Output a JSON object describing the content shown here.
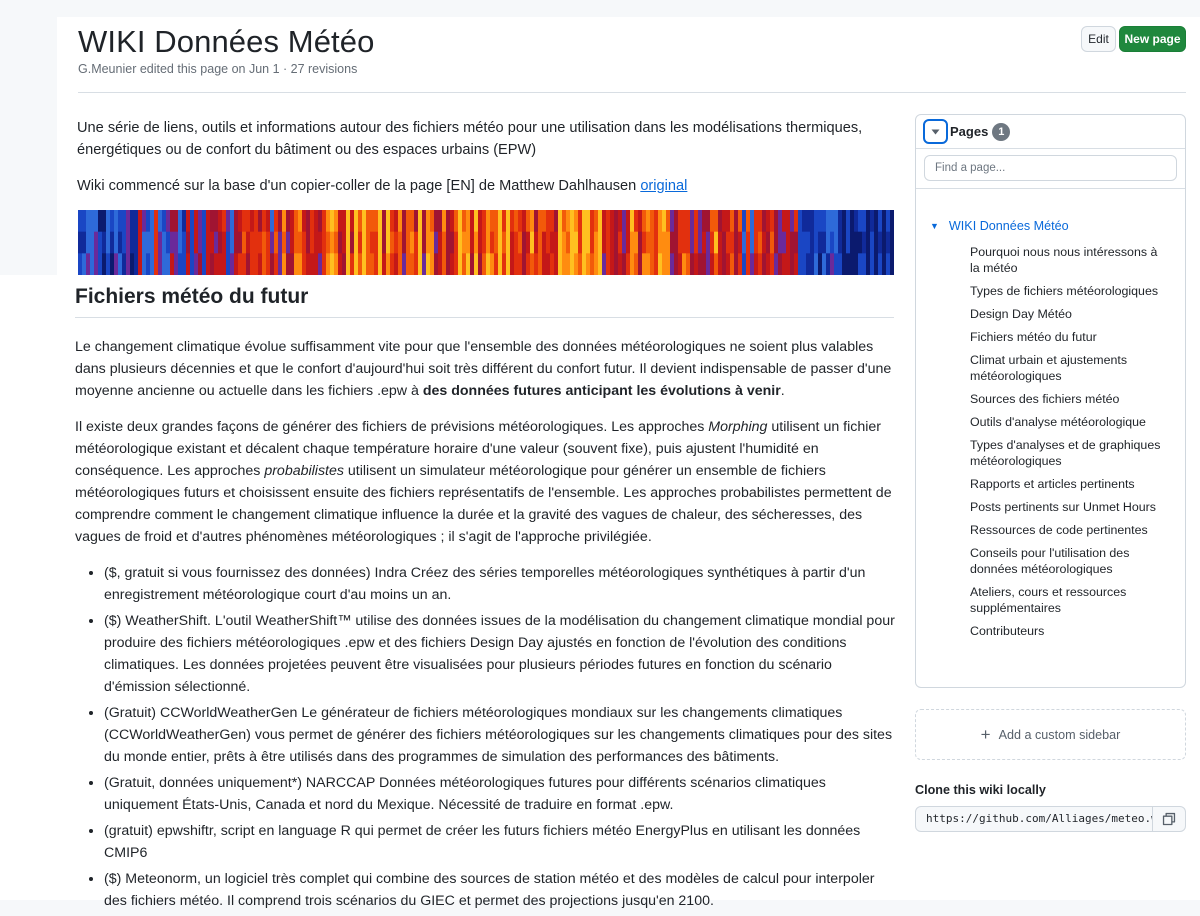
{
  "header": {
    "title": "WIKI Données Météo",
    "subtitle": "G.Meunier edited this page on Jun 1 · 27 revisions",
    "edit_label": "Edit",
    "new_page_label": "New page"
  },
  "intro": {
    "p1": "Une série de liens, outils et informations autour des fichiers météo pour une utilisation dans les modélisations thermiques, énergétiques ou de confort du bâtiment ou des espaces urbains (EPW)",
    "p2_text": "Wiki commencé sur la base d'un copier-coller de la page [EN] de Matthew Dahlhausen ",
    "p2_link": "original"
  },
  "section": {
    "heading": "Fichiers météo du futur",
    "p1_text": "Le changement climatique évolue suffisamment vite pour que l'ensemble des données météorologiques ne soient plus valables dans plusieurs décennies et que le confort d'aujourd'hui soit très différent du confort futur. Il devient indispensable de passer d'une moyenne ancienne ou actuelle dans les fichiers .epw à ",
    "p1_bold": "des données futures anticipant les évolutions à venir",
    "p1_end": ".",
    "p2_a": "Il existe deux grandes façons de générer des fichiers de prévisions météorologiques. Les approches ",
    "p2_em1": "Morphing",
    "p2_b": " utilisent un fichier météorologique existant et décalent chaque température horaire d'une valeur (souvent fixe), puis ajustent l'humidité en conséquence. Les approches ",
    "p2_em2": "probabilistes",
    "p2_c": " utilisent un simulateur météorologique pour générer un ensemble de fichiers météorologiques futurs et choisissent ensuite des fichiers représentatifs de l'ensemble. Les approches probabilistes permettent de comprendre comment le changement climatique influence la durée et la gravité des vagues de chaleur, des sécheresses, des vagues de froid et d'autres phénomènes météorologiques ; il s'agit de l'approche privilégiée.",
    "items": [
      {
        "prefix": "($, gratuit si vous fournissez des données) ",
        "link": "Indra",
        "text": " Créez des séries temporelles météorologiques synthétiques à partir d'un enregistrement météorologique court d'au moins un an."
      },
      {
        "prefix": "($) ",
        "link": "WeatherShift",
        "text": ". L'outil WeatherShift™ utilise des données issues de la modélisation du changement climatique mondial pour produire des fichiers météorologiques .epw et des fichiers Design Day ajustés en fonction de l'évolution des conditions climatiques. Les données projetées peuvent être visualisées pour plusieurs périodes futures en fonction du scénario d'émission sélectionné."
      },
      {
        "prefix": "(Gratuit) ",
        "link": "CCWorldWeatherGen",
        "text": " Le générateur de fichiers météorologiques mondiaux sur les changements climatiques (CCWorldWeatherGen) vous permet de générer des fichiers météorologiques sur les changements climatiques pour des sites du monde entier, prêts à être utilisés dans des programmes de simulation des performances des bâtiments."
      },
      {
        "prefix": "(Gratuit, données uniquement*) ",
        "link": "NARCCAP",
        "text": " Données météorologiques futures pour différents scénarios climatiques uniquement États-Unis, Canada et nord du Mexique. Nécessité de traduire en format .epw."
      },
      {
        "prefix": "(gratuit) ",
        "link": "epwshiftr",
        "text": ", script en language R qui permet de créer les futurs fichiers météo EnergyPlus en utilisant les données CMIP6"
      },
      {
        "prefix": "($) ",
        "link": "Meteonorm",
        "text": ", un logiciel très complet qui combine des sources de station météo et des modèles de calcul pour interpoler des fichiers météo. Il comprend trois scénarios du GIEC et permet des projections jusqu'en 2100."
      }
    ]
  },
  "sidebar": {
    "pages_label": "Pages",
    "pages_count": "1",
    "find_placeholder": "Find a page...",
    "root": "WIKI Données Météo",
    "items": [
      "Pourquoi nous nous intéressons à la météo",
      "Types de fichiers météorologiques",
      "Design Day Météo",
      "Fichiers météo du futur",
      "Climat urbain et ajustements météorologiques",
      "Sources des fichiers météo",
      "Outils d'analyse météorologique",
      "Types d'analyses et de graphiques météorologiques",
      "Rapports et articles pertinents",
      "Posts pertinents sur Unmet Hours",
      "Ressources de code pertinentes",
      "Conseils pour l'utilisation des données météorologiques",
      "Ateliers, cours et ressources supplémentaires",
      "Contributeurs"
    ],
    "custom_sidebar_label": "Add a custom sidebar",
    "clone_title": "Clone this wiki locally",
    "clone_url": "https://github.com/Alliages/meteo.wiki.git",
    "icons": {
      "toggle": "caret-down-icon",
      "copy": "copy-icon",
      "add": "plus-icon"
    }
  },
  "colors": {
    "link": "#0969da",
    "primary_button": "#1f883d",
    "border": "#d0d7de"
  }
}
